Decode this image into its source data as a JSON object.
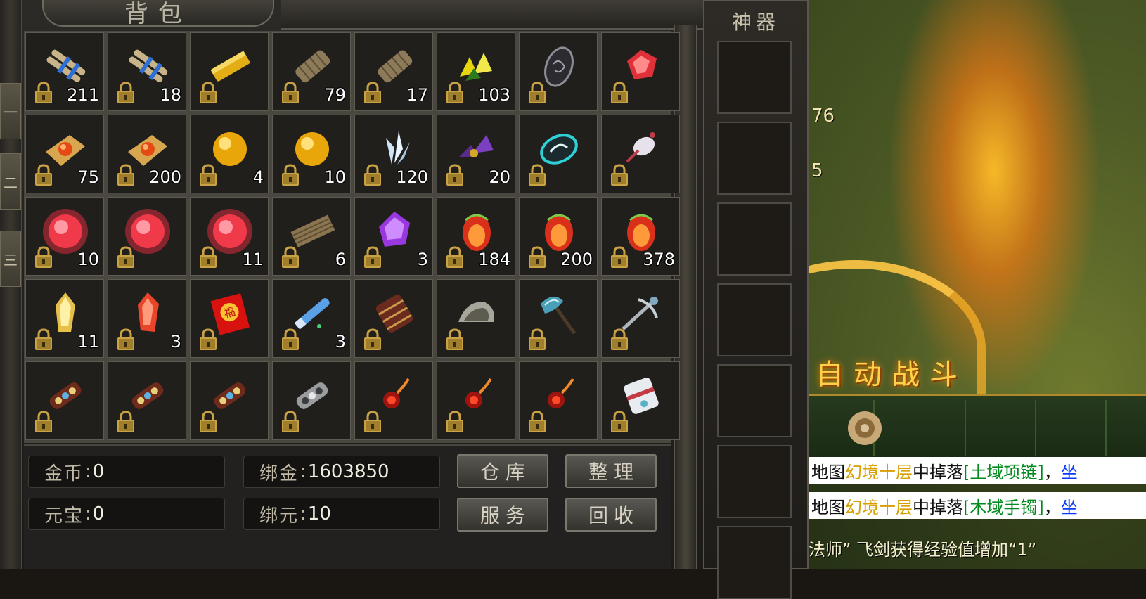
{
  "bag": {
    "title": "背包",
    "left_tabs": [
      "一",
      "二",
      "三"
    ],
    "items": [
      {
        "icon": "scroll-bundle-blue-icon",
        "count": "211"
      },
      {
        "icon": "scroll-bundle-blue-icon",
        "count": "18"
      },
      {
        "icon": "gold-bar-icon",
        "count": ""
      },
      {
        "icon": "bamboo-scroll-icon",
        "count": "79"
      },
      {
        "icon": "bamboo-scroll-icon",
        "count": "17"
      },
      {
        "icon": "yellow-crystal-shards-icon",
        "count": "103"
      },
      {
        "icon": "dark-leaf-gem-icon",
        "count": ""
      },
      {
        "icon": "red-crystal-icon",
        "count": ""
      },
      {
        "icon": "orange-gem-cloth-icon",
        "count": "75"
      },
      {
        "icon": "orange-gem-cloth-icon",
        "count": "200"
      },
      {
        "icon": "gold-orb-icon",
        "count": "4"
      },
      {
        "icon": "gold-orb-icon",
        "count": "10"
      },
      {
        "icon": "ice-crystal-icon",
        "count": "120"
      },
      {
        "icon": "purple-gem-cluster-icon",
        "count": "20"
      },
      {
        "icon": "cyan-swirl-amulet-icon",
        "count": ""
      },
      {
        "icon": "white-feather-pouch-icon",
        "count": ""
      },
      {
        "icon": "red-glow-orb-icon",
        "count": "10"
      },
      {
        "icon": "red-glow-orb-icon",
        "count": ""
      },
      {
        "icon": "red-glow-orb-icon",
        "count": "11"
      },
      {
        "icon": "wooden-plank-scroll-icon",
        "count": "6"
      },
      {
        "icon": "purple-gem-icon",
        "count": "3"
      },
      {
        "icon": "fire-egg-icon",
        "count": "184"
      },
      {
        "icon": "fire-egg-icon",
        "count": "200"
      },
      {
        "icon": "fire-egg-icon",
        "count": "378"
      },
      {
        "icon": "gold-crystal-icon",
        "count": "11"
      },
      {
        "icon": "red-crystal-shard-icon",
        "count": "3"
      },
      {
        "icon": "red-lucky-envelope-icon",
        "count": ""
      },
      {
        "icon": "blue-telescope-icon",
        "count": "3"
      },
      {
        "icon": "ornate-armor-icon",
        "count": ""
      },
      {
        "icon": "silver-helmet-icon",
        "count": ""
      },
      {
        "icon": "battle-axe-icon",
        "count": ""
      },
      {
        "icon": "silver-crossbow-icon",
        "count": ""
      },
      {
        "icon": "jeweled-ornament-icon",
        "count": ""
      },
      {
        "icon": "jeweled-ornament-icon",
        "count": ""
      },
      {
        "icon": "jeweled-ornament-icon",
        "count": ""
      },
      {
        "icon": "silver-ornament-icon",
        "count": ""
      },
      {
        "icon": "red-beaded-charm-icon",
        "count": ""
      },
      {
        "icon": "red-beaded-charm-icon",
        "count": ""
      },
      {
        "icon": "red-beaded-charm-icon",
        "count": ""
      },
      {
        "icon": "white-cloth-bundle-icon",
        "count": ""
      }
    ],
    "gold": {
      "label": "金币",
      "sep": ":",
      "value": "0"
    },
    "bound_gold": {
      "label": "绑金",
      "sep": ":",
      "value": "1603850"
    },
    "yuanbao": {
      "label": "元宝",
      "sep": ":",
      "value": "0"
    },
    "bound_yuanbao": {
      "label": "绑元",
      "sep": ":",
      "value": "10"
    },
    "buttons": {
      "warehouse": "仓库",
      "sort": "整理",
      "service": "服务",
      "recycle": "回收"
    }
  },
  "artifact": {
    "title": "神器",
    "slot_count": 7
  },
  "close_icon": "×",
  "world": {
    "auto_battle": "自动战斗",
    "num1": "76",
    "num2": "5",
    "chat": [
      {
        "parts": [
          {
            "t": "地图",
            "c": ""
          },
          {
            "t": "幻境十层",
            "c": "cl-yellow"
          },
          {
            "t": "中掉落",
            "c": ""
          },
          {
            "t": "[土域项链]",
            "c": "cl-green"
          },
          {
            "t": "，",
            "c": ""
          },
          {
            "t": "坐",
            "c": "cl-blue"
          }
        ]
      },
      {
        "parts": [
          {
            "t": "地图",
            "c": ""
          },
          {
            "t": "幻境十层",
            "c": "cl-yellow"
          },
          {
            "t": "中掉落",
            "c": ""
          },
          {
            "t": "[木域手镯]",
            "c": "cl-green"
          },
          {
            "t": "，",
            "c": ""
          },
          {
            "t": "坐",
            "c": "cl-blue"
          }
        ]
      }
    ],
    "system_line": "法师” 飞剑获得经验值增加“1”"
  },
  "colors": {
    "count_text": "#ffffff",
    "chat_item": "#008a1e",
    "chat_map": "#d7a000",
    "close_bg": "#9a140d"
  }
}
